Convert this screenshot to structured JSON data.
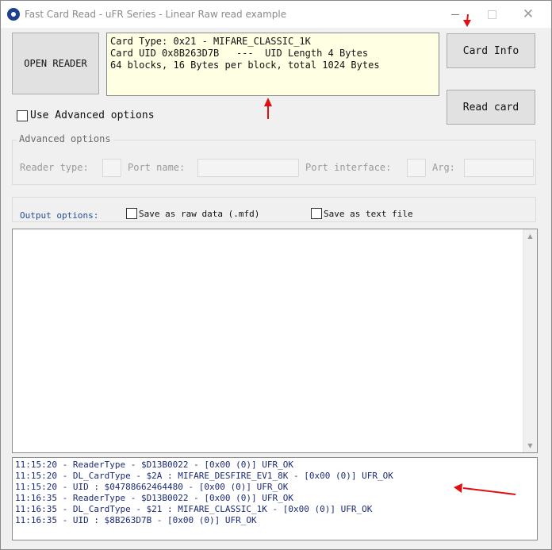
{
  "window": {
    "title": "Fast Card Read - uFR Series - Linear Raw read example",
    "close_glyph": "✕",
    "icon": "app-logo-icon"
  },
  "buttons": {
    "open_reader": "OPEN READER",
    "card_info": "Card Info",
    "read_card": "Read card"
  },
  "card_info_text": "Card Type: 0x21 - MIFARE_CLASSIC_1K\nCard UID 0x8B263D7B   ---  UID Length 4 Bytes\n64 blocks, 16 Bytes per block, total 1024 Bytes",
  "advanced": {
    "checkbox_label": "Use Advanced options",
    "checked": false,
    "group_title": "Advanced options",
    "reader_type_label": "Reader type:",
    "port_name_label": "Port name:",
    "port_interface_label": "Port interface:",
    "arg_label": "Arg:",
    "reader_type_value": "",
    "port_name_value": "",
    "port_interface_value": "",
    "arg_value": ""
  },
  "output": {
    "label": "Output options:",
    "save_raw_label": "Save as raw data (.mfd)",
    "save_text_label": "Save as text file",
    "save_raw_checked": false,
    "save_text_checked": false
  },
  "data_area": {
    "content": "",
    "scroll_up_glyph": "▲",
    "scroll_down_glyph": "▼"
  },
  "log": [
    "11:15:20 - ReaderType - $D13B0022 - [0x00 (0)] UFR_OK",
    "11:15:20 - DL_CardType - $2A : MIFARE_DESFIRE_EV1_8K - [0x00 (0)] UFR_OK",
    "11:15:20 - UID : $04788662464480 - [0x00 (0)] UFR_OK",
    "11:16:35 - ReaderType - $D13B0022 - [0x00 (0)] UFR_OK",
    "11:16:35 - DL_CardType - $21 : MIFARE_CLASSIC_1K - [0x00 (0)] UFR_OK",
    "11:16:35 - UID : $8B263D7B - [0x00 (0)] UFR_OK"
  ],
  "colors": {
    "annotation_arrow": "#e01010",
    "card_text_bg": "#ffffe3",
    "log_text": "#1a2a7a"
  }
}
